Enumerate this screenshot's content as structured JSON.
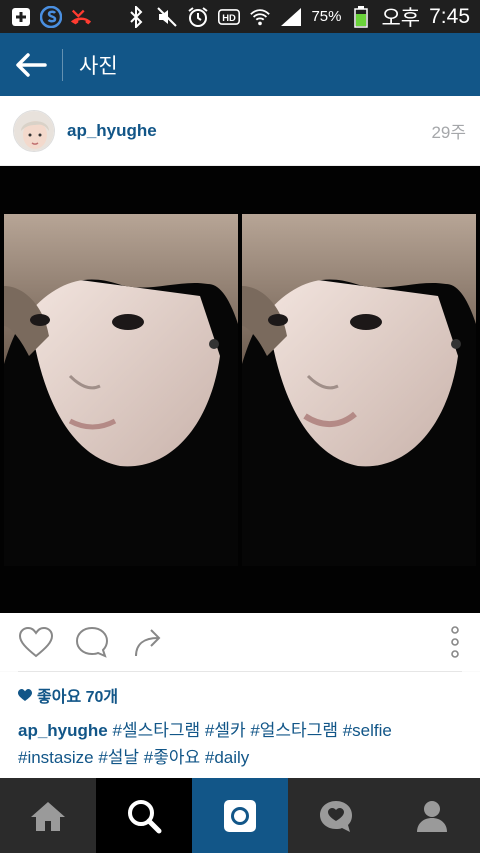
{
  "status_bar": {
    "battery": "75%",
    "ampm": "오후",
    "time": "7:45",
    "icons": [
      "plus-box-icon",
      "s-app-icon",
      "missed-call-icon",
      "bluetooth-icon",
      "mute-icon",
      "alarm-icon",
      "hd-icon",
      "wifi-icon",
      "signal-icon",
      "battery-icon"
    ]
  },
  "app_bar": {
    "title": "사진",
    "back_icon": "arrow-left-icon"
  },
  "post": {
    "username": "ap_hyughe",
    "time_ago": "29주",
    "likes": "좋아요 70개",
    "caption_user": "ap_hyughe",
    "caption_line1": "#셀스타그램 #셀카 #얼스타그램 #selfie",
    "caption_line2": "#instasize #설날 #좋아요 #daily"
  },
  "colors": {
    "brand": "#125688",
    "status_bar": "#1f1f1f",
    "bottom_nav": "#2b2b2b",
    "time_gray": "#a5a7aa"
  },
  "actions": [
    "heart-icon",
    "comment-icon",
    "share-icon",
    "more-icon"
  ],
  "bottom_nav": [
    "home-icon",
    "search-icon",
    "camera-icon",
    "activity-icon",
    "profile-icon"
  ]
}
